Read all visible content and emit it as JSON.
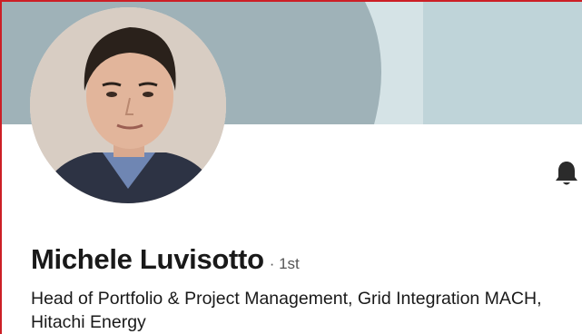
{
  "profile": {
    "name": "Michele Luvisotto",
    "degree": "· 1st",
    "headline": "Head of Portfolio & Project Management, Grid Integration MACH, Hitachi Energy"
  },
  "icons": {
    "notify": "bell-icon"
  },
  "colors": {
    "cover_dark": "#9fb2b8",
    "cover_light": "#d5e3e6",
    "cover_right": "#bfd4d9",
    "frame_border": "#cc1f26",
    "name_text": "#191919",
    "degree_text": "#555555"
  }
}
